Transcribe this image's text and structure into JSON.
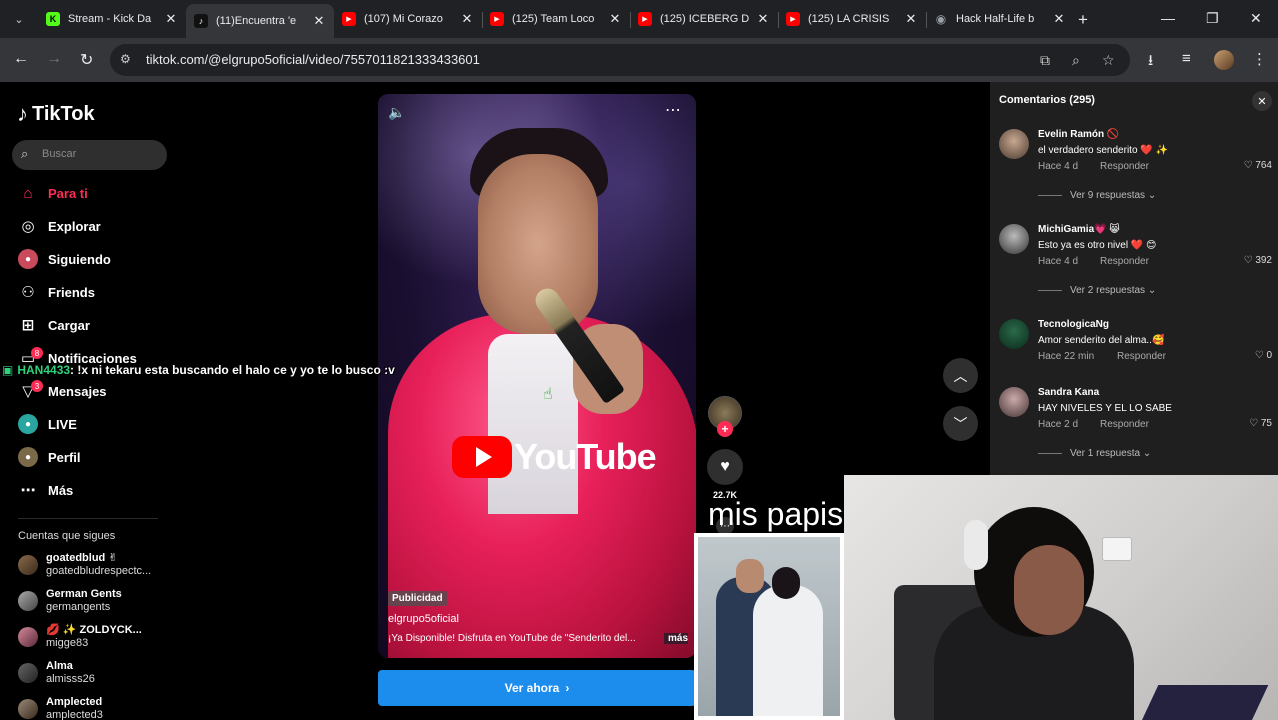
{
  "browser": {
    "tabs": [
      {
        "title": "Stream - Kick Da",
        "favicon": "K",
        "color": "#53fc18",
        "active": false
      },
      {
        "title": "(11)Encuentra 'e",
        "favicon": "♪",
        "color": "#000000",
        "active": true
      },
      {
        "title": "(107) Mi Corazo",
        "favicon": "▶",
        "color": "#ff0000",
        "active": false
      },
      {
        "title": "(125) Team Loco",
        "favicon": "▶",
        "color": "#ff0000",
        "active": false
      },
      {
        "title": "(125) ICEBERG D",
        "favicon": "▶",
        "color": "#ff0000",
        "active": false
      },
      {
        "title": "(125) LA CRISIS",
        "favicon": "▶",
        "color": "#ff0000",
        "active": false
      },
      {
        "title": "Hack Half-Life b",
        "favicon": "◉",
        "color": "#9aa0a6",
        "active": false
      }
    ],
    "url": "tiktok.com/@elgrupo5oficial/video/7557011821333433601"
  },
  "sidebar": {
    "logo": "TikTok",
    "search_placeholder": "Buscar",
    "nav": [
      {
        "label": "Para ti",
        "icon": "home-icon",
        "active": true
      },
      {
        "label": "Explorar",
        "icon": "compass-icon",
        "active": false
      },
      {
        "label": "Siguiendo",
        "icon": "following-icon",
        "active": false
      },
      {
        "label": "Friends",
        "icon": "friends-icon",
        "active": false
      },
      {
        "label": "Cargar",
        "icon": "upload-icon",
        "active": false
      },
      {
        "label": "Notificaciones",
        "icon": "notifications-icon",
        "active": false,
        "badge": "8"
      },
      {
        "label": "Mensajes",
        "icon": "messages-icon",
        "active": false,
        "badge": "3"
      },
      {
        "label": "LIVE",
        "icon": "live-icon",
        "active": false
      },
      {
        "label": "Perfil",
        "icon": "profile-icon",
        "active": false
      },
      {
        "label": "Más",
        "icon": "more-icon",
        "active": false
      }
    ],
    "following_header": "Cuentas que sigues",
    "following": [
      {
        "name": "goatedblud ✌",
        "user": "goatedbludrespectc..."
      },
      {
        "name": "German Gents",
        "user": "germangents"
      },
      {
        "name": "💋 ✨ ZOLDYCK...",
        "user": "migge83"
      },
      {
        "name": "Alma",
        "user": "almisss26"
      },
      {
        "name": "Amplected",
        "user": "amplected3"
      }
    ]
  },
  "video": {
    "ad_label": "Publicidad",
    "author": "elgrupo5oficial",
    "description": "¡Ya Disponible!  Disfruta en YouTube de \"Senderito del...",
    "more": "más",
    "youtube_word": "YouTube",
    "cta": "Ver ahora"
  },
  "actions": {
    "likes": "22.7K"
  },
  "comments": {
    "title": "Comentarios (295)",
    "items": [
      {
        "name": "Evelin Ramón 🚫",
        "text": "el verdadero senderito ❤️ ✨",
        "time": "Hace 4 d",
        "reply": "Responder",
        "likes": "764",
        "more": "Ver 9 respuestas"
      },
      {
        "name": "MichiGamia💗 😸",
        "text": "Esto ya es otro nivel ❤️ 😊",
        "time": "Hace 4 d",
        "reply": "Responder",
        "likes": "392",
        "more": "Ver 2 respuestas"
      },
      {
        "name": "TecnologicaNg",
        "text": "Amor senderito del alma..🥰",
        "time": "Hace 22 min",
        "reply": "Responder",
        "likes": "0",
        "more": ""
      },
      {
        "name": "Sandra Kana",
        "text": "HAY NIVELES Y EL LO SABE",
        "time": "Hace 2 d",
        "reply": "Responder",
        "likes": "75",
        "more": "Ver 1 respuesta"
      }
    ]
  },
  "overlay": {
    "chat_user": "HAN4433",
    "chat_message": ": !x ni tekaru esta buscando el halo ce y yo te lo busco :v",
    "caption": "mis papis"
  }
}
